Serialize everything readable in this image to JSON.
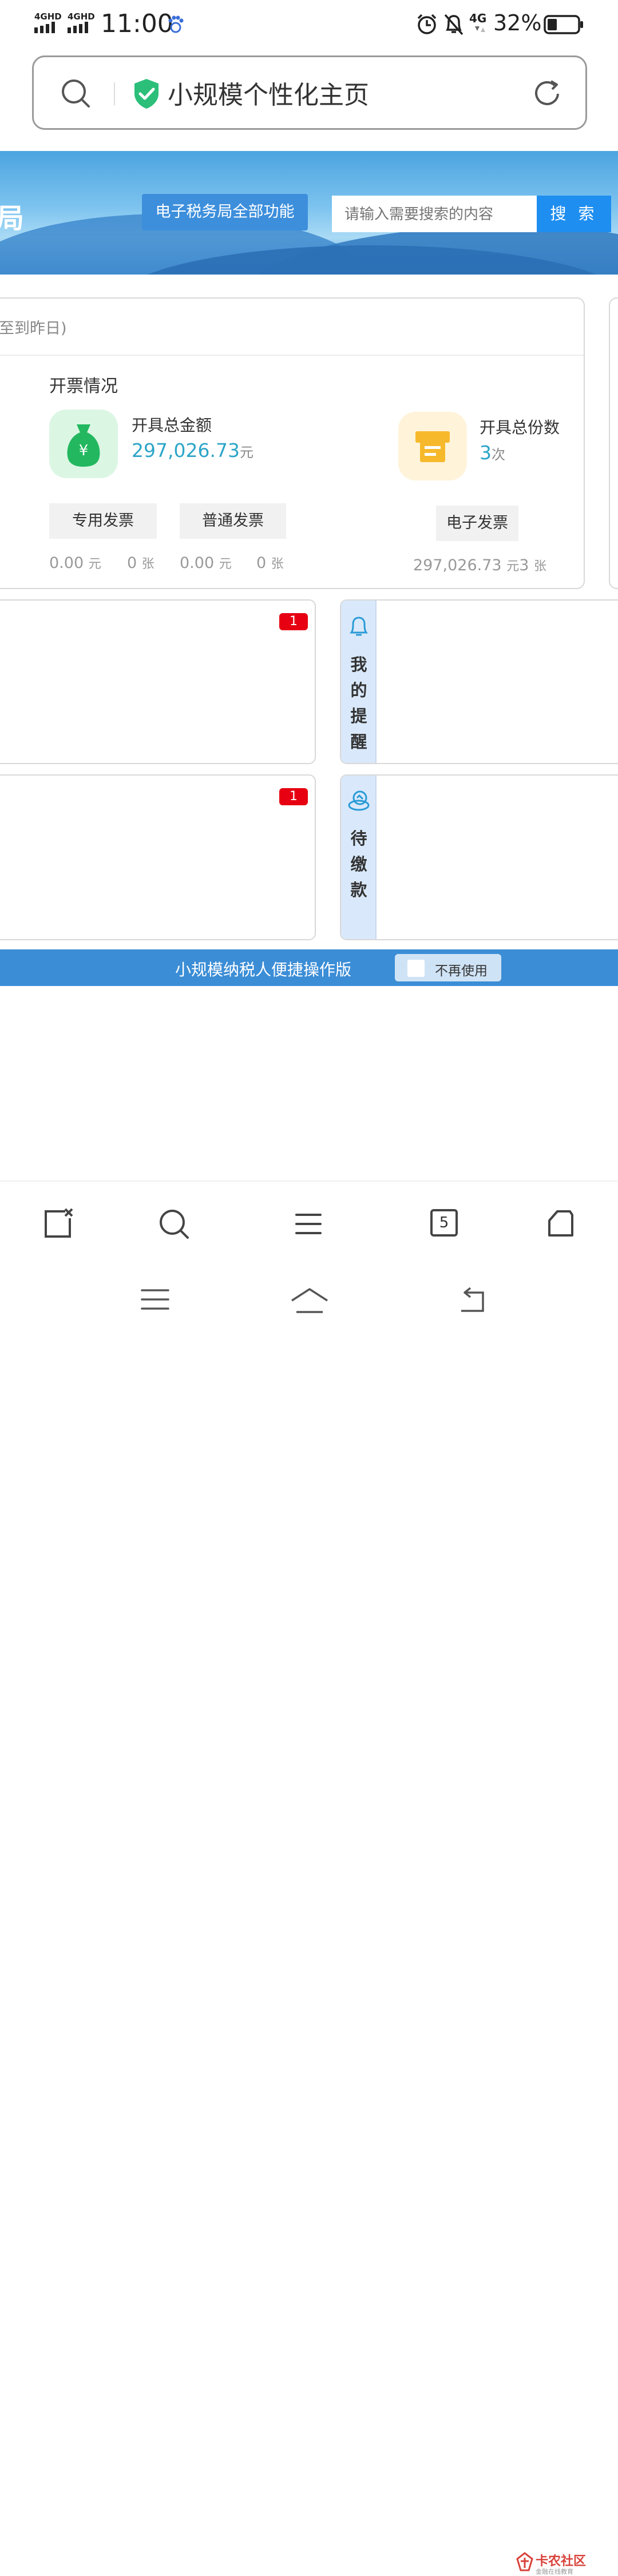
{
  "status_bar": {
    "network_1": "4GHD",
    "network_2": "4GHD",
    "time": "11:00",
    "network_3": "4G",
    "battery": "32%"
  },
  "address_bar": {
    "title": "小规模个性化主页"
  },
  "banner": {
    "edge_text": "局",
    "all_functions_button": "电子税务局全部功能",
    "search_placeholder": "请输入需要搜索的内容",
    "search_button": "搜 索"
  },
  "invoice_card": {
    "header_text": "至到昨日)",
    "section_title": "开票情况",
    "total_amount_label": "开具总金额",
    "total_amount_value": "297,026.73",
    "total_amount_unit": "元",
    "total_count_label": "开具总份数",
    "total_count_value": "3",
    "total_count_unit": "次",
    "special_invoice": {
      "label": "专用发票",
      "amount": "0.00",
      "amount_unit": "元",
      "count": "0",
      "count_unit": "张"
    },
    "normal_invoice": {
      "label": "普通发票",
      "amount": "0.00",
      "amount_unit": "元",
      "count": "0",
      "count_unit": "张"
    },
    "electronic_invoice": {
      "label": "电子发票",
      "amount": "297,026.73",
      "amount_unit": "元",
      "count": "3",
      "count_unit": "张"
    }
  },
  "panels": {
    "left_top_badge": "1",
    "left_bottom_badge": "1",
    "reminders_label": [
      "我",
      "的",
      "提",
      "醒"
    ],
    "pending_payment_label": [
      "待",
      "缴",
      "款"
    ]
  },
  "quick_bar": {
    "text": "小规模纳税人便捷操作版",
    "checkbox_label": "不再使用"
  },
  "browser_nav": {
    "tab_count": "5"
  },
  "watermark": {
    "title": "卡农社区",
    "subtitle": "金融在线教育"
  },
  "colors": {
    "accent": "#1e8ef0",
    "amount_text": "#2ca5c8",
    "badge": "#e60012",
    "quick_bar": "#3b8dd6"
  }
}
